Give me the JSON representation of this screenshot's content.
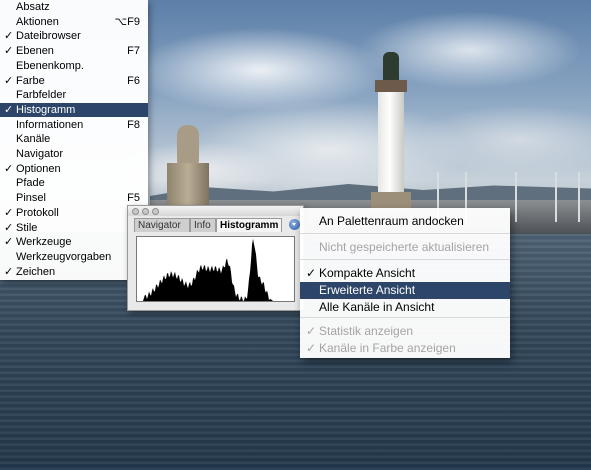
{
  "window_menu": {
    "items": [
      {
        "label": "Absatz",
        "checked": false,
        "shortcut": "",
        "selected": false
      },
      {
        "label": "Aktionen",
        "checked": false,
        "shortcut": "⌥F9",
        "selected": false
      },
      {
        "label": "Dateibrowser",
        "checked": true,
        "shortcut": "",
        "selected": false
      },
      {
        "label": "Ebenen",
        "checked": true,
        "shortcut": "F7",
        "selected": false
      },
      {
        "label": "Ebenenkomp.",
        "checked": false,
        "shortcut": "",
        "selected": false
      },
      {
        "label": "Farbe",
        "checked": true,
        "shortcut": "F6",
        "selected": false
      },
      {
        "label": "Farbfelder",
        "checked": false,
        "shortcut": "",
        "selected": false
      },
      {
        "label": "Histogramm",
        "checked": true,
        "shortcut": "",
        "selected": true
      },
      {
        "label": "Informationen",
        "checked": false,
        "shortcut": "F8",
        "selected": false
      },
      {
        "label": "Kanäle",
        "checked": false,
        "shortcut": "",
        "selected": false
      },
      {
        "label": "Navigator",
        "checked": false,
        "shortcut": "",
        "selected": false
      },
      {
        "label": "Optionen",
        "checked": true,
        "shortcut": "",
        "selected": false
      },
      {
        "label": "Pfade",
        "checked": false,
        "shortcut": "",
        "selected": false
      },
      {
        "label": "Pinsel",
        "checked": false,
        "shortcut": "F5",
        "selected": false
      },
      {
        "label": "Protokoll",
        "checked": true,
        "shortcut": "",
        "selected": false
      },
      {
        "label": "Stile",
        "checked": true,
        "shortcut": "",
        "selected": false
      },
      {
        "label": "Werkzeuge",
        "checked": true,
        "shortcut": "",
        "selected": false
      },
      {
        "label": "Werkzeugvorgaben",
        "checked": false,
        "shortcut": "",
        "selected": false
      },
      {
        "label": "Zeichen",
        "checked": true,
        "shortcut": "",
        "selected": false
      }
    ]
  },
  "palette": {
    "tabs": [
      {
        "label": "Navigator",
        "active": false
      },
      {
        "label": "Info",
        "active": false
      },
      {
        "label": "Histogramm",
        "active": true
      }
    ]
  },
  "palette_menu": {
    "items": [
      {
        "label": "An Palettenraum andocken",
        "checked": false,
        "enabled": true,
        "selected": false
      },
      {
        "label": "Nicht gespeicherte aktualisieren",
        "checked": false,
        "enabled": false,
        "selected": false
      },
      {
        "label": "Kompakte Ansicht",
        "checked": true,
        "enabled": true,
        "selected": false
      },
      {
        "label": "Erweiterte Ansicht",
        "checked": false,
        "enabled": true,
        "selected": true
      },
      {
        "label": "Alle Kanäle in Ansicht",
        "checked": false,
        "enabled": true,
        "selected": false
      },
      {
        "label": "Statistik anzeigen",
        "checked": true,
        "enabled": false,
        "selected": false
      },
      {
        "label": "Kanäle in Farbe anzeigen",
        "checked": true,
        "enabled": false,
        "selected": false
      }
    ]
  },
  "colors": {
    "selection": "#2d4568",
    "histogram_fill": "#000000",
    "disabled_text": "#a4a4a4"
  }
}
